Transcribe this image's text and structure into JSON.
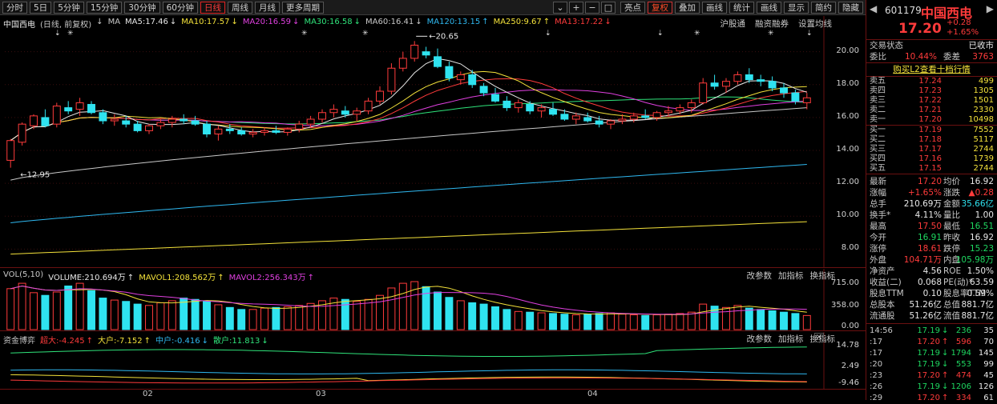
{
  "toolbar": {
    "periods": [
      "分时",
      "5日",
      "5分钟",
      "15分钟",
      "30分钟",
      "60分钟",
      "日线",
      "周线",
      "月线",
      "更多周期"
    ],
    "active_period": "日线",
    "menus": [
      "亮点",
      "复权",
      "叠加",
      "画线",
      "统计",
      "画线",
      "显示",
      "简约",
      "隐藏"
    ],
    "active_menu": "复权",
    "win_buttons": [
      "⌄",
      "+",
      "−",
      "□"
    ]
  },
  "main_legend": {
    "stock": "中国西电",
    "mode": "(日线, 前复权)",
    "arrow": "↓",
    "ma_prefix": "MA",
    "items": [
      {
        "label": "MA5:17.46",
        "arrow": "↓",
        "color": "#e8e8e8"
      },
      {
        "label": "MA10:17.57",
        "arrow": "↓",
        "color": "#f3e13a"
      },
      {
        "label": "MA20:16.59",
        "arrow": "↓",
        "color": "#e040e0"
      },
      {
        "label": "MA30:16.58",
        "arrow": "↓",
        "color": "#2fe37a"
      },
      {
        "label": "MA60:16.41",
        "arrow": "↓",
        "color": "#c8c8c8"
      },
      {
        "label": "MA120:13.15",
        "arrow": "↑",
        "color": "#2fb8f0"
      },
      {
        "label": "MA250:9.67",
        "arrow": "↑",
        "color": "#f3e13a"
      },
      {
        "label": "MA13:17.22",
        "arrow": "↓",
        "color": "#ff3b3b"
      }
    ],
    "right_links": [
      "沪股通",
      "融资融券",
      "设置均线"
    ]
  },
  "price_axis": [
    "20.00",
    "18.00",
    "16.00",
    "14.00",
    "12.00",
    "10.00",
    "8.00"
  ],
  "annotations": {
    "high": "20.65",
    "low": "12.95"
  },
  "volume_legend": {
    "title": "VOL(5,10)",
    "items": [
      {
        "label": "VOLUME:210.694万",
        "arrow": "↑",
        "color": "#e8e8e8"
      },
      {
        "label": "MAVOL1:208.562万",
        "arrow": "↑",
        "color": "#f3e13a"
      },
      {
        "label": "MAVOL2:256.343万",
        "arrow": "↑",
        "color": "#e040e0"
      }
    ],
    "right_links": [
      "改参数",
      "加指标",
      "换指标"
    ],
    "axis": [
      "715.00",
      "358.00",
      "0.00"
    ]
  },
  "capital_legend": {
    "title": "资金博弈",
    "items": [
      {
        "label": "超大:-4.245",
        "arrow": "↑",
        "color": "#ff3b3b"
      },
      {
        "label": "大户:-7.152",
        "arrow": "↑",
        "color": "#f3e13a"
      },
      {
        "label": "中户:-0.416",
        "arrow": "↓",
        "color": "#2fb8f0"
      },
      {
        "label": "散户:11.813",
        "arrow": "↓",
        "color": "#2fe37a"
      }
    ],
    "right_links": [
      "改参数",
      "加指标",
      "换指标"
    ],
    "axis": [
      "14.78",
      "2.49",
      "-9.46"
    ]
  },
  "date_axis": [
    "02",
    "03",
    "04"
  ],
  "quote": {
    "code": "601179",
    "name": "中国西电",
    "price": "17.20",
    "change": "+0.28",
    "change_pct": "+1.65%",
    "trade_status_label": "交易状态",
    "trade_status": "已收市",
    "weibi_label": "委比",
    "weibi": "10.44%",
    "weicha_label": "委差",
    "weicha": "3763",
    "l2_link": "购买L2查看十档行情",
    "asks": [
      {
        "label": "卖五",
        "price": "17.24",
        "qty": "499"
      },
      {
        "label": "卖四",
        "price": "17.23",
        "qty": "1305"
      },
      {
        "label": "卖三",
        "price": "17.22",
        "qty": "1501"
      },
      {
        "label": "卖二",
        "price": "17.21",
        "qty": "2330"
      },
      {
        "label": "卖一",
        "price": "17.20",
        "qty": "10498"
      }
    ],
    "bids": [
      {
        "label": "买一",
        "price": "17.19",
        "qty": "7552"
      },
      {
        "label": "买二",
        "price": "17.18",
        "qty": "5117"
      },
      {
        "label": "买三",
        "price": "17.17",
        "qty": "2744"
      },
      {
        "label": "买四",
        "price": "17.16",
        "qty": "1739"
      },
      {
        "label": "买五",
        "price": "17.15",
        "qty": "2744"
      }
    ],
    "stats": [
      {
        "l1": "最新",
        "v1": "17.20",
        "c1": "red",
        "l2": "均价",
        "v2": "16.92",
        "c2": "white"
      },
      {
        "l1": "涨幅",
        "v1": "+1.65%",
        "c1": "red",
        "l2": "涨跌",
        "v2": "▲0.28",
        "c2": "red"
      },
      {
        "l1": "总手",
        "v1": "210.69万",
        "c1": "white",
        "l2": "金额",
        "v2": "35.66亿",
        "c2": "cyan"
      },
      {
        "l1": "换手*",
        "v1": "4.11%",
        "c1": "white",
        "l2": "量比",
        "v2": "1.00",
        "c2": "white"
      },
      {
        "l1": "最高",
        "v1": "17.50",
        "c1": "red",
        "l2": "最低",
        "v2": "16.51",
        "c2": "green"
      },
      {
        "l1": "今开",
        "v1": "16.91",
        "c1": "green",
        "l2": "昨收",
        "v2": "16.92",
        "c2": "white"
      },
      {
        "l1": "涨停",
        "v1": "18.61",
        "c1": "red",
        "l2": "跌停",
        "v2": "15.23",
        "c2": "green"
      },
      {
        "l1": "外盘",
        "v1": "104.71万",
        "c1": "red",
        "l2": "内盘",
        "v2": "105.98万",
        "c2": "green"
      },
      {
        "l1": "净资产",
        "v1": "4.56",
        "c1": "white",
        "l2": "ROE",
        "v2": "1.50%",
        "c2": "white"
      },
      {
        "l1": "收益(二)",
        "v1": "0.068",
        "c1": "white",
        "l2": "PE(动)*",
        "v2": "63.59",
        "c2": "white"
      },
      {
        "l1": "股息TTM",
        "v1": "0.10",
        "c1": "white",
        "l2": "股息率TTM",
        "v2": "0.59%",
        "c2": "white"
      },
      {
        "l1": "总股本",
        "v1": "51.26亿",
        "c1": "white",
        "l2": "总值",
        "v2": "881.7亿",
        "c2": "white"
      },
      {
        "l1": "流通股",
        "v1": "51.26亿",
        "c1": "white",
        "l2": "流值",
        "v2": "881.7亿",
        "c2": "white"
      }
    ],
    "ticks": [
      {
        "time": "14:56",
        "price": "17.19",
        "pc": "green",
        "qty": "236",
        "qc": "green",
        "flag": "35"
      },
      {
        "time": ":17",
        "price": "17.20",
        "pc": "red",
        "qty": "596",
        "qc": "red",
        "flag": "70"
      },
      {
        "time": ":17",
        "price": "17.19",
        "pc": "green",
        "qty": "1794",
        "qc": "green",
        "flag": "145"
      },
      {
        "time": ":20",
        "price": "17.19",
        "pc": "green",
        "qty": "553",
        "qc": "green",
        "flag": "99"
      },
      {
        "time": ":23",
        "price": "17.20",
        "pc": "red",
        "qty": "474",
        "qc": "red",
        "flag": "45"
      },
      {
        "time": ":26",
        "price": "17.19",
        "pc": "green",
        "qty": "1206",
        "qc": "green",
        "flag": "126"
      },
      {
        "time": ":29",
        "price": "17.20",
        "pc": "red",
        "qty": "334",
        "qc": "red",
        "flag": "61"
      }
    ]
  },
  "chart_data": {
    "type": "candlestick",
    "title": "中国西电 (日线, 前复权)",
    "ylim": [
      7.0,
      21.2
    ],
    "candles": [
      [
        13.4,
        14.7,
        12.95,
        14.6
      ],
      [
        14.5,
        15.7,
        14.3,
        15.6
      ],
      [
        15.5,
        16.2,
        15.3,
        16.1
      ],
      [
        16.0,
        16.5,
        15.4,
        15.5
      ],
      [
        15.6,
        16.9,
        15.4,
        16.7
      ],
      [
        16.6,
        17.0,
        16.2,
        16.4
      ],
      [
        16.5,
        17.2,
        16.1,
        16.9
      ],
      [
        16.8,
        17.0,
        16.2,
        16.3
      ],
      [
        16.3,
        16.5,
        15.6,
        15.8
      ],
      [
        15.8,
        16.2,
        15.5,
        15.9
      ],
      [
        15.8,
        16.1,
        15.4,
        15.6
      ],
      [
        15.6,
        15.8,
        15.1,
        15.2
      ],
      [
        15.2,
        15.6,
        15.0,
        15.5
      ],
      [
        15.5,
        15.9,
        15.3,
        15.7
      ],
      [
        15.7,
        16.1,
        15.4,
        15.9
      ],
      [
        15.9,
        16.2,
        15.6,
        15.8
      ],
      [
        15.8,
        16.1,
        15.5,
        15.6
      ],
      [
        15.6,
        15.8,
        14.8,
        15.0
      ],
      [
        15.0,
        15.5,
        14.6,
        15.3
      ],
      [
        15.3,
        15.6,
        15.0,
        15.2
      ],
      [
        15.2,
        15.4,
        14.9,
        15.0
      ],
      [
        15.0,
        15.3,
        14.8,
        15.1
      ],
      [
        15.1,
        15.4,
        14.9,
        15.2
      ],
      [
        15.2,
        15.5,
        15.0,
        15.1
      ],
      [
        15.1,
        15.4,
        14.9,
        15.3
      ],
      [
        15.3,
        15.8,
        15.1,
        15.6
      ],
      [
        15.6,
        16.1,
        15.4,
        15.9
      ],
      [
        15.9,
        16.5,
        15.7,
        16.3
      ],
      [
        16.3,
        16.8,
        16.0,
        16.5
      ],
      [
        16.4,
        16.7,
        16.0,
        16.2
      ],
      [
        16.2,
        16.6,
        15.8,
        16.4
      ],
      [
        16.4,
        17.2,
        16.2,
        17.0
      ],
      [
        17.0,
        17.9,
        16.8,
        17.6
      ],
      [
        17.6,
        19.3,
        17.4,
        19.0
      ],
      [
        19.0,
        20.0,
        18.8,
        19.6
      ],
      [
        19.6,
        20.65,
        19.4,
        20.4
      ],
      [
        20.0,
        20.3,
        19.6,
        19.8
      ],
      [
        19.7,
        20.2,
        19.0,
        19.1
      ],
      [
        19.1,
        19.4,
        18.2,
        18.4
      ],
      [
        18.3,
        18.8,
        18.0,
        18.6
      ],
      [
        18.6,
        18.9,
        17.8,
        18.0
      ],
      [
        17.9,
        18.1,
        17.3,
        17.5
      ],
      [
        17.4,
        17.8,
        16.9,
        17.0
      ],
      [
        17.0,
        17.3,
        16.4,
        16.6
      ],
      [
        16.6,
        17.1,
        16.3,
        16.9
      ],
      [
        16.8,
        17.0,
        16.2,
        16.4
      ],
      [
        16.4,
        16.8,
        16.0,
        16.6
      ],
      [
        16.5,
        16.9,
        16.1,
        16.2
      ],
      [
        16.2,
        16.5,
        15.8,
        15.9
      ],
      [
        15.9,
        16.3,
        15.6,
        16.1
      ],
      [
        16.0,
        16.3,
        15.7,
        15.8
      ],
      [
        15.8,
        16.1,
        15.4,
        15.6
      ],
      [
        15.6,
        15.9,
        15.3,
        15.8
      ],
      [
        15.8,
        16.2,
        15.6,
        15.9
      ],
      [
        15.9,
        16.3,
        15.7,
        16.1
      ],
      [
        16.1,
        16.5,
        15.9,
        16.0
      ],
      [
        16.0,
        16.4,
        15.8,
        16.3
      ],
      [
        16.3,
        16.7,
        16.1,
        16.4
      ],
      [
        16.4,
        16.8,
        16.2,
        16.6
      ],
      [
        16.6,
        17.1,
        16.3,
        16.9
      ],
      [
        16.9,
        18.4,
        16.8,
        18.1
      ],
      [
        18.1,
        18.6,
        17.7,
        17.9
      ],
      [
        17.9,
        18.4,
        17.5,
        18.2
      ],
      [
        18.2,
        18.8,
        18.0,
        18.6
      ],
      [
        18.6,
        19.0,
        18.1,
        18.3
      ],
      [
        18.3,
        18.6,
        17.9,
        18.2
      ],
      [
        18.2,
        18.5,
        17.6,
        17.8
      ],
      [
        17.8,
        18.1,
        17.2,
        17.5
      ],
      [
        17.5,
        17.7,
        16.8,
        17.0
      ],
      [
        16.9,
        17.5,
        16.5,
        17.2
      ]
    ],
    "volume": [
      610,
      690,
      550,
      510,
      560,
      650,
      690,
      580,
      470,
      440,
      420,
      380,
      360,
      400,
      430,
      470,
      450,
      420,
      370,
      330,
      300,
      300,
      320,
      330,
      340,
      360,
      390,
      430,
      470,
      450,
      420,
      450,
      510,
      620,
      690,
      715,
      640,
      560,
      480,
      430,
      400,
      380,
      340,
      300,
      270,
      260,
      250,
      240,
      230,
      220,
      230,
      240,
      250,
      230,
      220,
      210,
      220,
      230,
      240,
      260,
      380,
      350,
      330,
      360,
      320,
      300,
      280,
      260,
      240,
      210
    ],
    "volume_ylim": [
      0,
      715
    ],
    "capital": {
      "ylim": [
        -9.46,
        14.78
      ],
      "series": [
        {
          "name": "散户",
          "color": "#2fe37a"
        },
        {
          "name": "中户",
          "color": "#2fb8f0"
        },
        {
          "name": "大户",
          "color": "#f3e13a"
        },
        {
          "name": "超大",
          "color": "#ff3b3b"
        }
      ]
    }
  }
}
